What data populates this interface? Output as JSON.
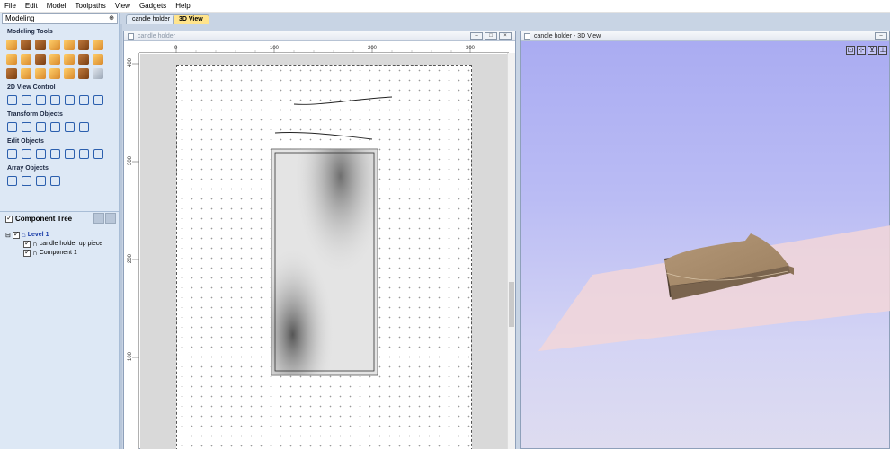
{
  "menu": [
    "File",
    "Edit",
    "Model",
    "Toolpaths",
    "View",
    "Gadgets",
    "Help"
  ],
  "left_panel": {
    "mode_select": "Modeling",
    "sections": [
      {
        "title": "Modeling Tools"
      },
      {
        "title": "2D View Control"
      },
      {
        "title": "Transform Objects"
      },
      {
        "title": "Edit Objects"
      },
      {
        "title": "Array Objects"
      }
    ],
    "component_tree": {
      "title": "Component Tree",
      "level": "Level 1",
      "items": [
        "candle holder up piece",
        "Component 1"
      ]
    }
  },
  "tabs": [
    "candle holder",
    "3D View"
  ],
  "view2d": {
    "title": "candle holder",
    "ruler_top": [
      "0",
      "100",
      "200",
      "300"
    ],
    "ruler_left": [
      "400",
      "300",
      "200",
      "100"
    ]
  },
  "view3d": {
    "title": "candle holder - 3D View"
  },
  "colors": {
    "panel_bg": "#dde8f5",
    "active_tab": "#ffe48c",
    "sky_top": "#a9abf2",
    "material_plane": "#f2d6d8",
    "model_wood": "#a88a6c"
  }
}
